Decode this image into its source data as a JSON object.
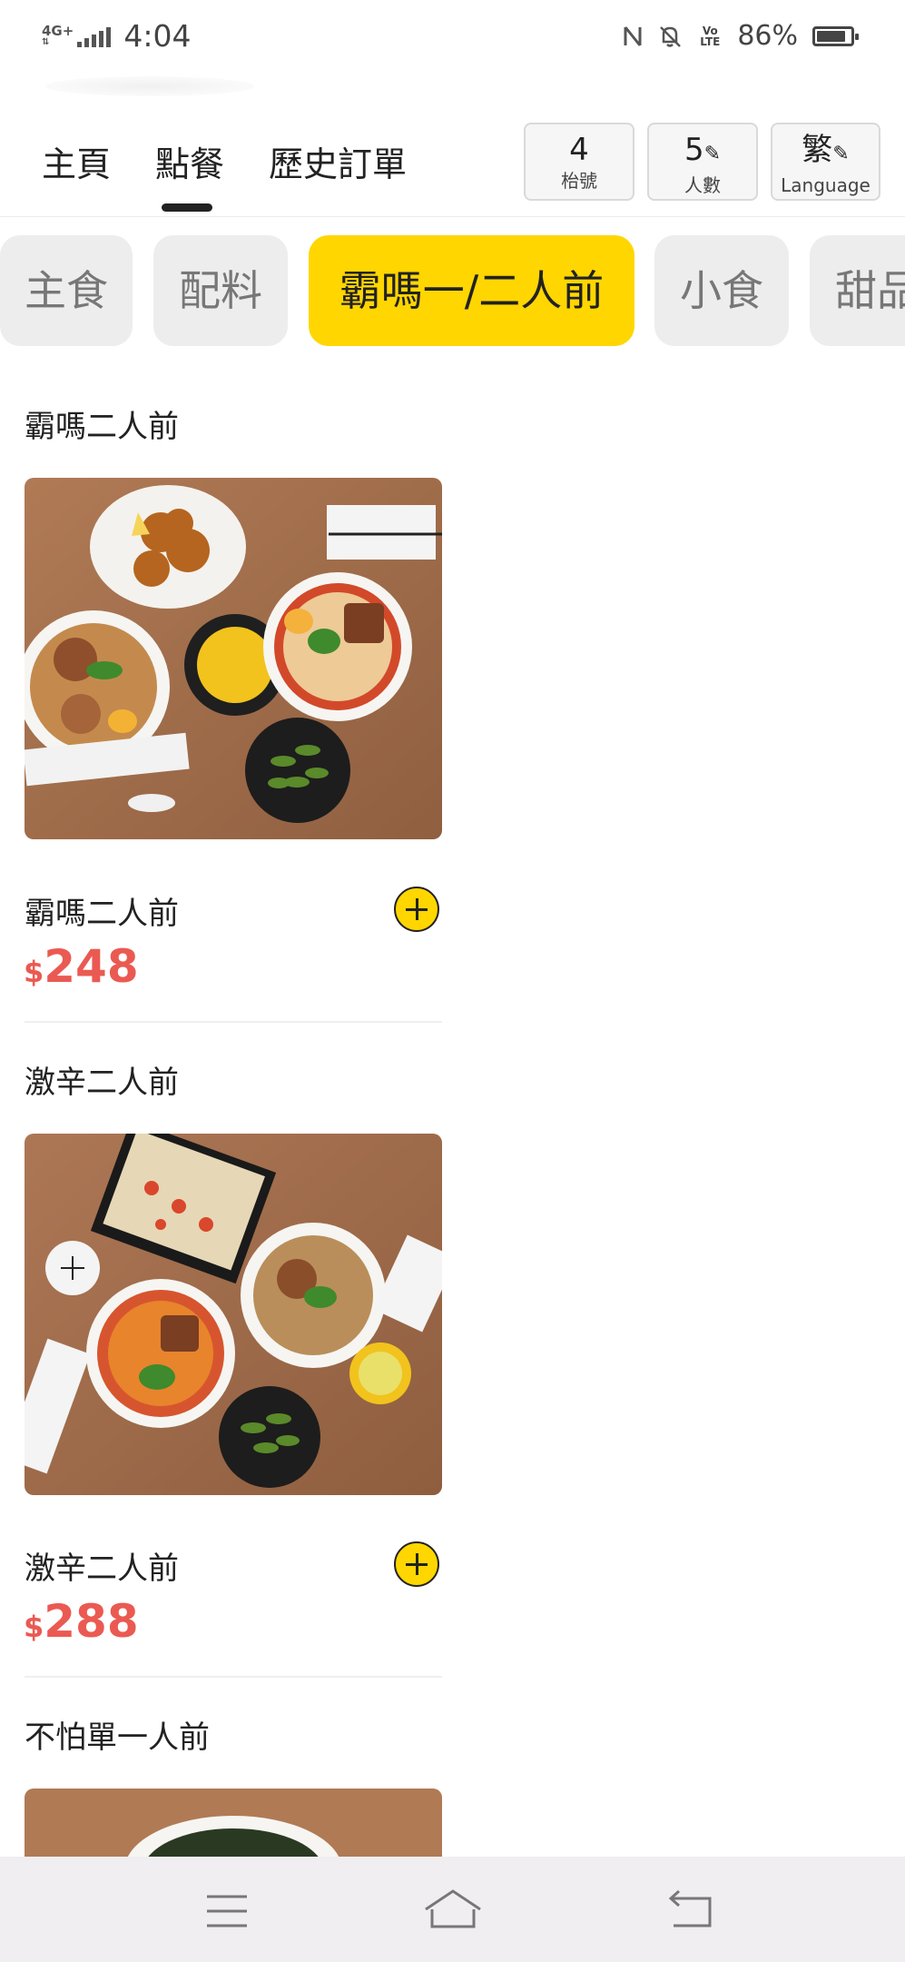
{
  "status_bar": {
    "network": "4G+",
    "time": "4:04",
    "volte": "Vo LTE",
    "battery_percent": "86%",
    "battery_level": 0.86,
    "icons": [
      "nfc-icon",
      "mute-bell-icon",
      "volte-icon",
      "battery-icon"
    ]
  },
  "nav": {
    "tabs": [
      {
        "label": "主頁",
        "active": false
      },
      {
        "label": "點餐",
        "active": true
      },
      {
        "label": "歷史訂單",
        "active": false
      }
    ],
    "table_no": {
      "value": "4",
      "label": "枱號"
    },
    "people": {
      "value": "5",
      "label": "人數",
      "icon": "pencil-icon"
    },
    "language": {
      "value": "繁",
      "label": "Language",
      "icon": "pencil-icon"
    }
  },
  "categories": [
    {
      "label": "主食",
      "active": false
    },
    {
      "label": "配料",
      "active": false
    },
    {
      "label": "霸嗎一/二人前",
      "active": true
    },
    {
      "label": "小食",
      "active": false
    },
    {
      "label": "甜品",
      "active": false
    }
  ],
  "menu": [
    {
      "section": "霸嗎二人前",
      "name": "霸嗎二人前",
      "currency": "$",
      "price": "248"
    },
    {
      "section": "激辛二人前",
      "name": "激辛二人前",
      "currency": "$",
      "price": "288"
    },
    {
      "section": "不怕單一人前"
    }
  ],
  "colors": {
    "accent": "#ffd600",
    "price": "#ea5a52"
  },
  "system_nav": {
    "icons": [
      "menu-icon",
      "home-icon",
      "back-icon"
    ]
  }
}
